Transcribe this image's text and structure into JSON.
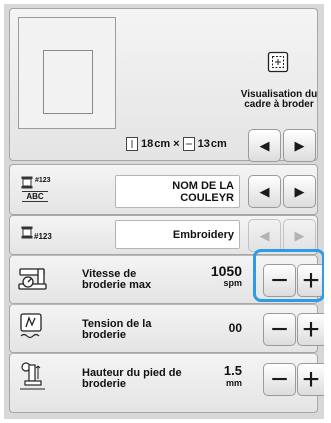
{
  "frame_preview": {
    "size_width": "18",
    "size_height": "13",
    "unit": "cm",
    "times": "×",
    "view_label": "Visualisation du cadre à broder"
  },
  "thread_color_row": {
    "code_icon_text": "#123",
    "code_icon_sub": "ABC",
    "color_name": "NOM DE LA COULEYR"
  },
  "thread_number_row": {
    "code_icon_text": "#123",
    "value": "Embroidery"
  },
  "settings": [
    {
      "label": "Vitesse de broderie max",
      "value": "1050",
      "unit": "spm"
    },
    {
      "label": "Tension de la broderie",
      "value": "00",
      "unit": ""
    },
    {
      "label": "Hauteur du pied de broderie",
      "value": "1.5",
      "unit": "mm"
    }
  ],
  "buttons": {
    "left_arrow": "◀",
    "right_arrow": "▶",
    "minus": "−",
    "plus": "+"
  },
  "colors": {
    "highlight": "#2e9be8",
    "panel": "#ececec"
  }
}
